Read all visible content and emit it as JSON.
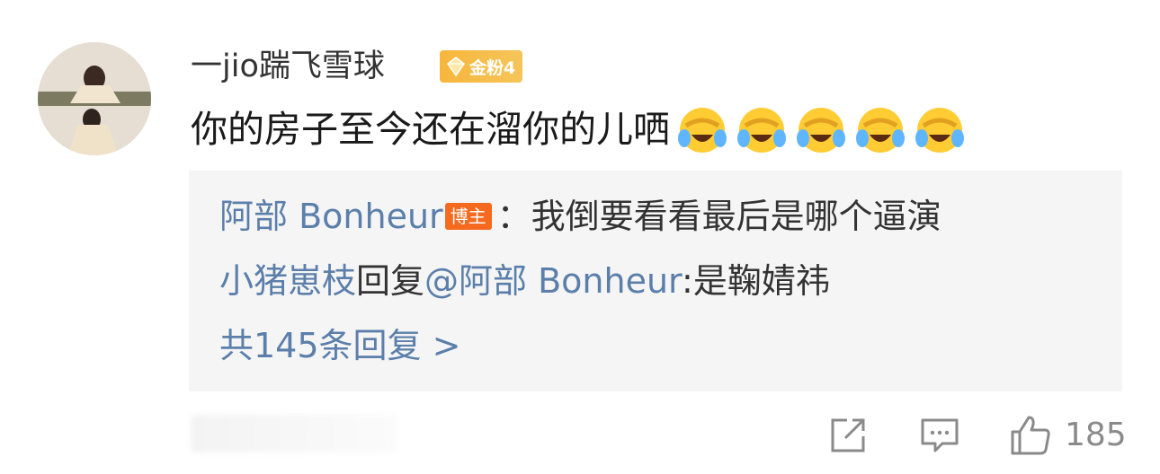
{
  "comment": {
    "username": "一jio踹飞雪球",
    "fan_badge": "金粉4",
    "text": "你的房子至今还在溜你的儿哂",
    "emojis": [
      "laughing-crying-emoji",
      "laughing-crying-emoji",
      "laughing-crying-emoji",
      "laughing-crying-emoji",
      "laughing-crying-emoji"
    ]
  },
  "replies": {
    "reply1": {
      "author": "阿部 Bonheur",
      "author_badge": "博主",
      "separator": "：",
      "text": "我倒要看看最后是哪个逼演"
    },
    "reply2": {
      "author": "小猪崽枝",
      "action": "回复",
      "mention": "@阿部 Bonheur",
      "colon": ":",
      "text": "是鞠婧祎"
    },
    "more_label": "共145条回复 >"
  },
  "actions": {
    "share_icon": "share-icon",
    "comment_icon": "comment-icon",
    "like_icon": "thumbs-up-icon",
    "like_count": "185"
  },
  "colors": {
    "link": "#5b7faa",
    "host_badge": "#f66a1f",
    "fan_badge": "#f7b63c",
    "reply_bg": "#f5f5f5"
  }
}
